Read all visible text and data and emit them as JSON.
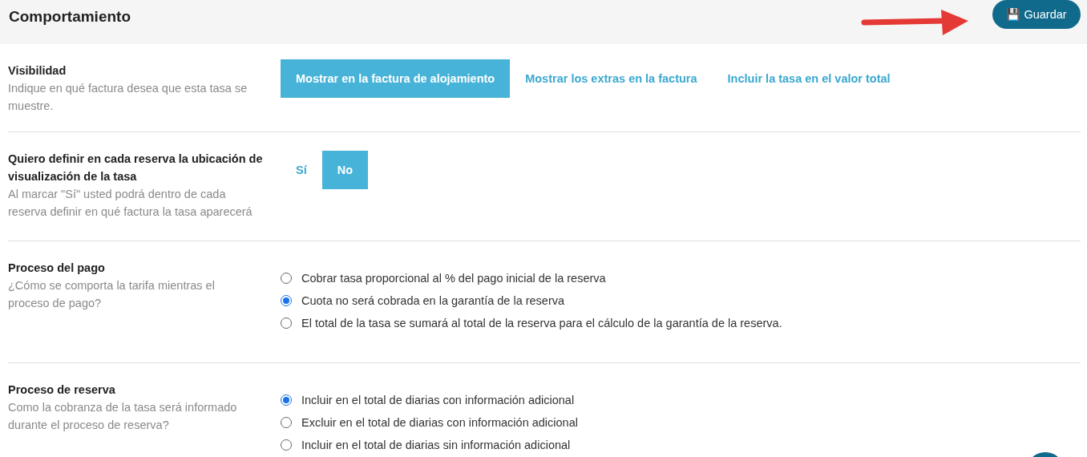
{
  "header": {
    "title": "Comportamiento",
    "save_button": {
      "icon": "💾",
      "label": "Guardar"
    }
  },
  "sections": [
    {
      "kind": "segmented",
      "title": "Visibilidad",
      "description": "Indique en qué factura desea que esta tasa se muestre.",
      "options": [
        {
          "label": "Mostrar en la factura de alojamiento",
          "selected": true
        },
        {
          "label": "Mostrar los extras en la factura",
          "selected": false
        },
        {
          "label": "Incluir la tasa en el valor total",
          "selected": false
        }
      ]
    },
    {
      "kind": "segmented",
      "title": "Quiero definir en cada reserva la ubicación de visualización de la tasa",
      "description": "Al marcar \"Sí\" usted podrá dentro de cada reserva definir en qué factura la tasa aparecerá",
      "options": [
        {
          "label": "Sí",
          "selected": false
        },
        {
          "label": "No",
          "selected": true
        }
      ]
    },
    {
      "kind": "radio",
      "title": "Proceso del pago",
      "description": "¿Cómo se comporta la tarifa mientras el proceso de pago?",
      "options": [
        {
          "label": "Cobrar tasa proporcional al % del pago inicial de la reserva",
          "selected": false
        },
        {
          "label": "Cuota no será cobrada en la garantía de la reserva",
          "selected": true
        },
        {
          "label": "El total de la tasa se sumará al total de la reserva para el cálculo de la garantía de la reserva.",
          "selected": false
        }
      ]
    },
    {
      "kind": "radio",
      "title": "Proceso de reserva",
      "description": "Como la cobranza de la tasa será informado durante el proceso de reserva?",
      "options": [
        {
          "label": "Incluir en el total de diarias con información adicional",
          "selected": true
        },
        {
          "label": "Excluir en el total de diarias con información adicional",
          "selected": false
        },
        {
          "label": "Incluir en el total de diarias sin información adicional",
          "selected": false
        }
      ]
    }
  ]
}
